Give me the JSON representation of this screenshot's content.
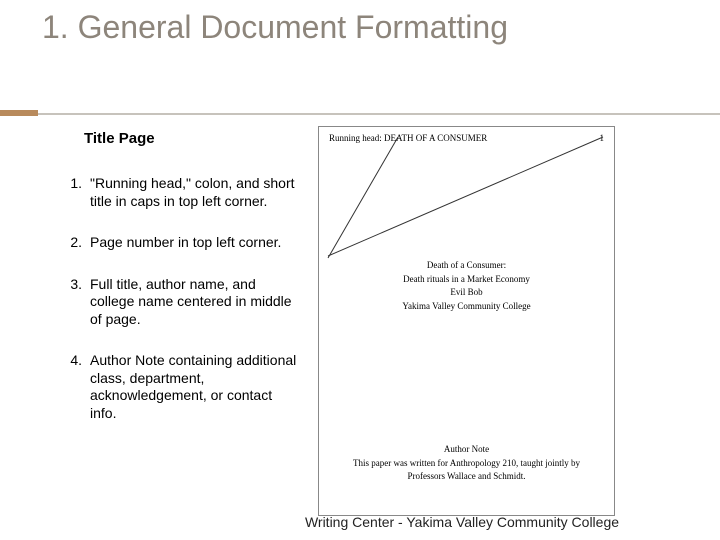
{
  "title": "1. General Document Formatting",
  "subtitle": "Title Page",
  "list": {
    "item1": "\"Running head,\" colon, and short title in caps in top left corner.",
    "item2": "Page number in top left corner.",
    "item3": "Full title, author name, and college name centered in middle of page.",
    "item4": "Author Note containing additional class, department, acknowledgement, or contact info."
  },
  "doc": {
    "running_head": "Running head: DEATH OF A CONSUMER",
    "page_number": "1",
    "center_line1": "Death of a Consumer:",
    "center_line2": "Death rituals in a Market Economy",
    "center_line3": "Evil Bob",
    "center_line4": "Yakima Valley Community College",
    "author_note_heading": "Author Note",
    "author_note_line1": "This paper was written for Anthropology 210, taught jointly by",
    "author_note_line2": "Professors Wallace and Schmidt."
  },
  "footer": "Writing Center - Yakima Valley Community College"
}
